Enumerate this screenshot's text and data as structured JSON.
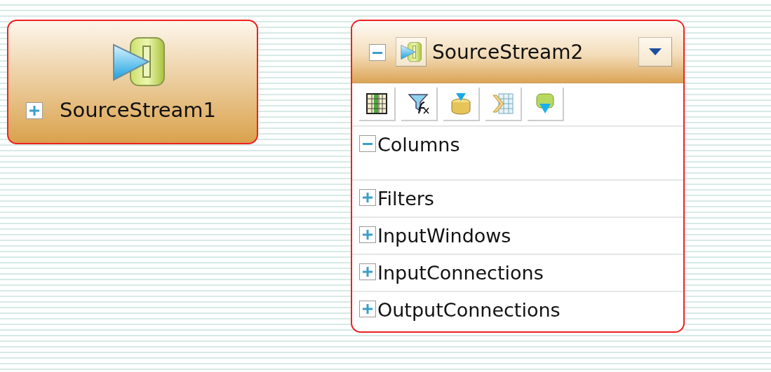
{
  "nodes": [
    {
      "kind": "compact",
      "title": "SourceStream1",
      "expanded": false,
      "selected": true
    },
    {
      "kind": "detailed",
      "title": "SourceStream2",
      "expanded": true,
      "selected": true,
      "sections": [
        {
          "label": "Columns",
          "expanded": true
        },
        {
          "label": "Filters",
          "expanded": false
        },
        {
          "label": "InputWindows",
          "expanded": false
        },
        {
          "label": "InputConnections",
          "expanded": false
        },
        {
          "label": "OutputConnections",
          "expanded": false
        }
      ]
    }
  ]
}
